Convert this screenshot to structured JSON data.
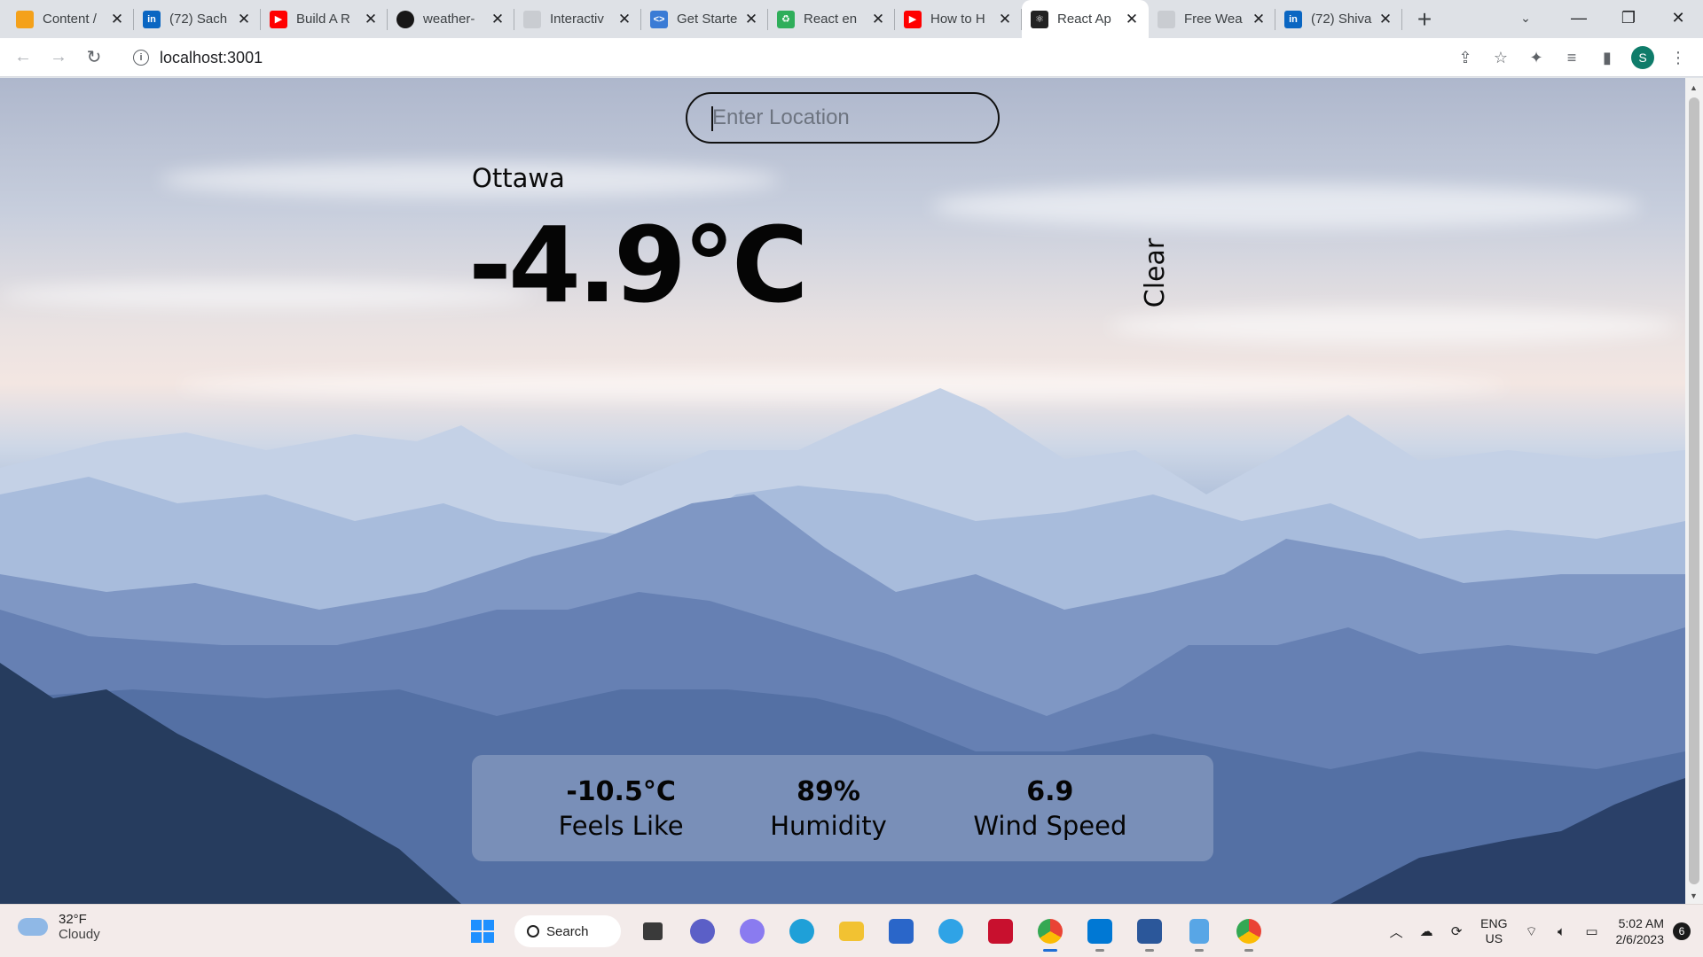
{
  "browser": {
    "tabs": [
      {
        "title": "Content /",
        "icon": "pencil-icon",
        "color": "#f4a11a"
      },
      {
        "title": "(72) Sach",
        "icon": "linkedin-icon",
        "color": "#0a66c2"
      },
      {
        "title": "Build A R",
        "icon": "youtube-icon",
        "color": "#ff0000"
      },
      {
        "title": "weather-",
        "icon": "github-icon",
        "color": "#181717"
      },
      {
        "title": "Interactiv",
        "icon": "page-icon",
        "color": "#c9ccd1"
      },
      {
        "title": "Get Starte",
        "icon": "dev-icon",
        "color": "#3a7bd5"
      },
      {
        "title": "React en",
        "icon": "recycle-icon",
        "color": "#2fae5a"
      },
      {
        "title": "How to H",
        "icon": "youtube-icon",
        "color": "#ff0000"
      },
      {
        "title": "React Ap",
        "icon": "react-icon",
        "color": "#222222",
        "active": true
      },
      {
        "title": "Free Wea",
        "icon": "page-icon",
        "color": "#c9ccd1"
      },
      {
        "title": "(72) Shiva",
        "icon": "linkedin-icon",
        "color": "#0a66c2"
      }
    ],
    "url": "localhost:3001",
    "profile_initial": "S"
  },
  "app": {
    "search_placeholder": "Enter Location",
    "location": "Ottawa",
    "temperature": "-4.9°C",
    "description": "Clear",
    "stats": [
      {
        "value": "-10.5°C",
        "label": "Feels Like"
      },
      {
        "value": "89%",
        "label": "Humidity"
      },
      {
        "value": "6.9",
        "label": "Wind Speed"
      }
    ]
  },
  "taskbar": {
    "weather_temp": "32°F",
    "weather_desc": "Cloudy",
    "search_label": "Search",
    "lang_line1": "ENG",
    "lang_line2": "US",
    "time": "5:02 AM",
    "date": "2/6/2023",
    "notification_count": "6"
  }
}
